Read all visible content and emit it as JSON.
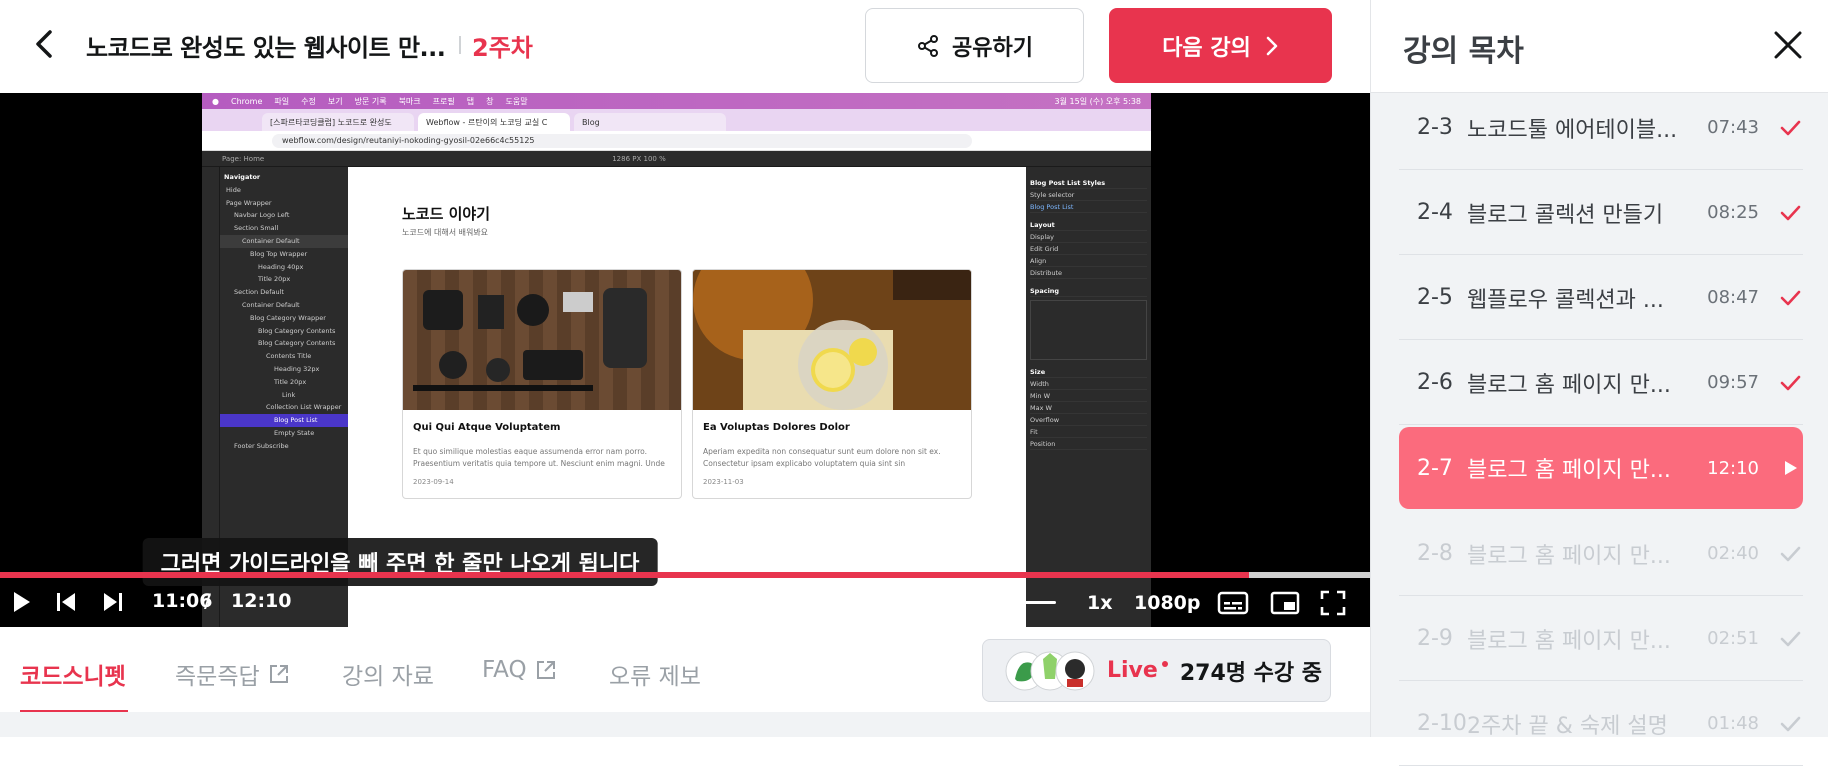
{
  "header": {
    "course_title": "노코드로 완성도 있는 웹사이트 만...",
    "week": "2주차",
    "share_label": "공유하기",
    "next_label": "다음 강의"
  },
  "video": {
    "current_time": "11:06",
    "time_separator": "/",
    "duration": "12:10",
    "progress_fraction": 0.912,
    "rate": "1x",
    "quality": "1080p",
    "caption": "그러면 가이드라인을 빼 주면 한 줄만 나오게 됩니다",
    "screen": {
      "mac_menu": [
        "Chrome",
        "파일",
        "수정",
        "보기",
        "방문 기록",
        "북마크",
        "프로필",
        "탭",
        "창",
        "도움말"
      ],
      "mac_clock": "3월 15일 (수) 오후 5:38",
      "tabs": [
        "[스파르타코딩클럽] 노코드로 완성도",
        "Webflow - 르탄이의 노코딩 교실 C",
        "Blog"
      ],
      "url": "webflow.com/design/reutaniyi-nokoding-gyosil-02e66c4c55125",
      "toolbar_text": "Page: Home",
      "zoom_text": "1286 PX  100 %",
      "navigator_title": "Navigator",
      "navigator_items": [
        "Hide",
        "Page Wrapper",
        "Navbar Logo Left",
        "Section Small",
        "Container Default",
        "Blog Top Wrapper",
        "Heading 40px",
        "Title 20px",
        "Section Default",
        "Container Default",
        "Blog Category Wrapper",
        "Blog Category Contents",
        "Blog Category Contents",
        "Contents Title",
        "Heading 32px",
        "Title 20px",
        "Link",
        "Collection List Wrapper",
        "Blog Post List",
        "Empty State",
        "Footer Subscribe"
      ],
      "blog_heading": "노코드 이야기",
      "blog_sub": "노코드에 대해서 배워봐요",
      "cards": [
        {
          "title": "Qui Qui Atque Voluptatem",
          "desc": "Et quo similique molestias eaque assumenda error nam porro. Praesentium veritatis quia tempore ut. Nesciunt enim magni. Unde",
          "date": "2023-09-14"
        },
        {
          "title": "Ea Voluptas Dolores Dolor",
          "desc": "Aperiam expedita non consequatur sunt eum dolore non sit ex. Consectetur ipsam explicabo voluptatem quia sint sin",
          "date": "2023-11-03"
        }
      ],
      "right_panel": [
        "Blog Post List Styles",
        "Style selector",
        "Blog Post List",
        "Layout",
        "Display",
        "Edit Grid",
        "Align",
        "Distribute",
        "Spacing",
        "Size",
        "Width",
        "Height",
        "Min W",
        "Min H",
        "Max W",
        "Max H",
        "Overflow",
        "Fit",
        "Position"
      ]
    }
  },
  "tabs": [
    {
      "label": "코드스니펫",
      "active": true,
      "external": false
    },
    {
      "label": "즉문즉답",
      "active": false,
      "external": true
    },
    {
      "label": "강의 자료",
      "active": false,
      "external": false
    },
    {
      "label": "FAQ",
      "active": false,
      "external": true
    },
    {
      "label": "오류 제보",
      "active": false,
      "external": false
    }
  ],
  "live": {
    "label": "Live",
    "count_text": "274명 수강 중"
  },
  "sidebar": {
    "title": "강의 목차",
    "lessons": [
      {
        "num": "2-3",
        "title": "노코드툴 에어테이블...",
        "duration": "07:43",
        "status": "done"
      },
      {
        "num": "2-4",
        "title": "블로그 콜렉션 만들기",
        "duration": "08:25",
        "status": "done"
      },
      {
        "num": "2-5",
        "title": "웹플로우 콜렉션과 ...",
        "duration": "08:47",
        "status": "done"
      },
      {
        "num": "2-6",
        "title": "블로그 홈 페이지 만...",
        "duration": "09:57",
        "status": "done"
      },
      {
        "num": "2-7",
        "title": "블로그 홈 페이지 만...",
        "duration": "12:10",
        "status": "playing"
      },
      {
        "num": "2-8",
        "title": "블로그 홈 페이지 만...",
        "duration": "02:40",
        "status": "todo"
      },
      {
        "num": "2-9",
        "title": "블로그 홈 페이지 만...",
        "duration": "02:51",
        "status": "todo"
      },
      {
        "num": "2-10",
        "title": "2주차 끝 & 숙제 설명",
        "duration": "01:48",
        "status": "todo"
      }
    ]
  },
  "colors": {
    "accent": "#e8344e",
    "current_lesson": "#fb6b7d",
    "done_check": "#e8344e",
    "todo_check": "#c8ccd1"
  }
}
